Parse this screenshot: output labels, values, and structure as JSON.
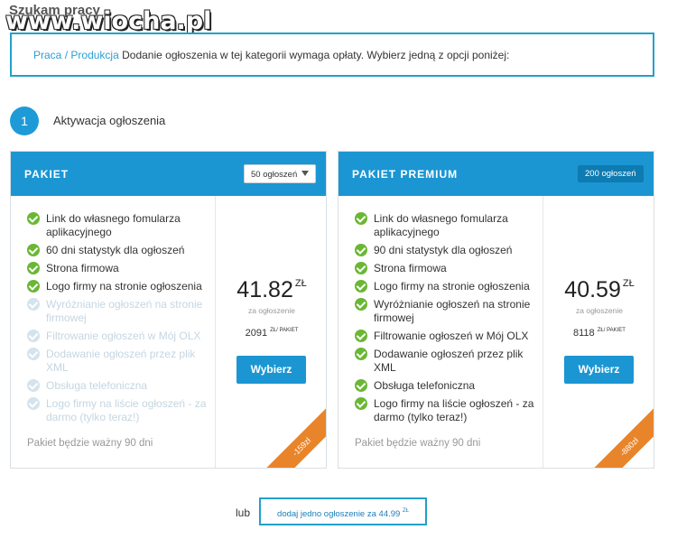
{
  "page": {
    "title": "Szukam pracy",
    "watermark": "www.wiocha.pl"
  },
  "info": {
    "category": "Praca",
    "separator": "/",
    "subcategory": "Produkcja",
    "message": "Dodanie ogłoszenia w tej kategorii wymaga opłaty. Wybierz jedną z opcji poniżej:"
  },
  "step": {
    "number": "1",
    "label": "Aktywacja ogłoszenia"
  },
  "packages": [
    {
      "title": "PAKIET",
      "selector": "50 ogłoszeń",
      "features": [
        {
          "text": "Link do własnego fomularza aplikacyjnego",
          "enabled": true
        },
        {
          "text": "60 dni statystyk dla ogłoszeń",
          "enabled": true
        },
        {
          "text": "Strona firmowa",
          "enabled": true
        },
        {
          "text": "Logo firmy na stronie ogłoszenia",
          "enabled": true
        },
        {
          "text": "Wyróżnianie ogłoszeń na stronie firmowej",
          "enabled": false
        },
        {
          "text": "Filtrowanie ogłoszeń w Mój OLX",
          "enabled": false
        },
        {
          "text": "Dodawanie ogłoszeń przez plik XML",
          "enabled": false
        },
        {
          "text": "Obsługa telefoniczna",
          "enabled": false
        },
        {
          "text": "Logo firmy na liście ogłoszeń - za darmo (tylko teraz!)",
          "enabled": false
        }
      ],
      "validity": "Pakiet będzie ważny 90 dni",
      "price": "41.82",
      "currency": "ZŁ",
      "per_label": "za ogłoszenie",
      "total": "2091",
      "total_unit": "ZŁ/ PAKIET",
      "button": "Wybierz",
      "discount": "-159zł"
    },
    {
      "title": "PAKIET PREMIUM",
      "badge": "200 ogłoszeń",
      "features": [
        {
          "text": "Link do własnego fomularza aplikacyjnego",
          "enabled": true
        },
        {
          "text": "90 dni statystyk dla ogłoszeń",
          "enabled": true
        },
        {
          "text": "Strona firmowa",
          "enabled": true
        },
        {
          "text": "Logo firmy na stronie ogłoszenia",
          "enabled": true
        },
        {
          "text": "Wyróżnianie ogłoszeń na stronie firmowej",
          "enabled": true
        },
        {
          "text": "Filtrowanie ogłoszeń w Mój OLX",
          "enabled": true
        },
        {
          "text": "Dodawanie ogłoszeń przez plik XML",
          "enabled": true
        },
        {
          "text": "Obsługa telefoniczna",
          "enabled": true
        },
        {
          "text": "Logo firmy na liście ogłoszeń - za darmo (tylko teraz!)",
          "enabled": true
        }
      ],
      "validity": "Pakiet będzie ważny 90 dni",
      "price": "40.59",
      "currency": "ZŁ",
      "per_label": "za ogłoszenie",
      "total": "8118",
      "total_unit": "ZŁ/ PAKIET",
      "button": "Wybierz",
      "discount": "-880zł"
    }
  ],
  "footer": {
    "or_label": "lub",
    "single_button": "dodaj jedno ogłoszenie za 44.99",
    "single_currency": "ZŁ"
  },
  "colors": {
    "primary": "#1b96d3",
    "check": "#6ab734",
    "ribbon": "#e8852a"
  }
}
